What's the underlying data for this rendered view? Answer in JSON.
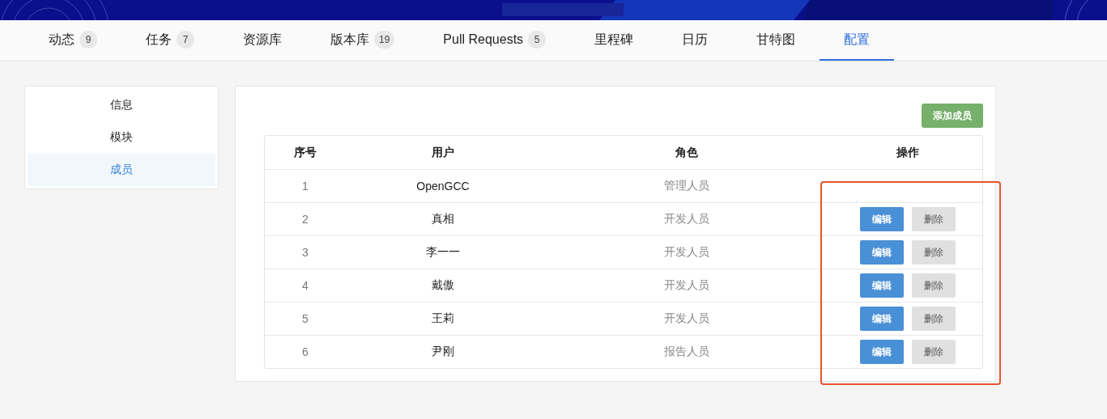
{
  "tabs": [
    {
      "label": "动态",
      "count": "9",
      "selected": false
    },
    {
      "label": "任务",
      "count": "7",
      "selected": false
    },
    {
      "label": "资源库",
      "selected": false
    },
    {
      "label": "版本库",
      "count": "19",
      "selected": false
    },
    {
      "label": "Pull Requests",
      "count": "5",
      "selected": false
    },
    {
      "label": "里程碑",
      "selected": false
    },
    {
      "label": "日历",
      "selected": false
    },
    {
      "label": "甘特图",
      "selected": false
    },
    {
      "label": "配置",
      "selected": true
    }
  ],
  "sidebar": {
    "items": [
      {
        "label": "信息",
        "selected": false
      },
      {
        "label": "模块",
        "selected": false
      },
      {
        "label": "成员",
        "selected": true
      }
    ]
  },
  "add_button": "添加成员",
  "table": {
    "columns": [
      "序号",
      "用户",
      "角色",
      "操作"
    ],
    "rows": [
      {
        "index": "1",
        "user": "OpenGCC",
        "role": "管理人员"
      },
      {
        "index": "2",
        "user": "真相",
        "role": "开发人员",
        "actions": [
          {
            "kind": "edit",
            "label": "编辑"
          },
          {
            "kind": "delete",
            "label": "删除"
          }
        ]
      },
      {
        "index": "3",
        "user": "李一一",
        "role": "开发人员",
        "actions": [
          {
            "kind": "edit",
            "label": "编辑"
          },
          {
            "kind": "delete",
            "label": "删除"
          }
        ]
      },
      {
        "index": "4",
        "user": "戴傲",
        "role": "开发人员",
        "actions": [
          {
            "kind": "edit",
            "label": "编辑"
          },
          {
            "kind": "delete",
            "label": "删除"
          }
        ]
      },
      {
        "index": "5",
        "user": "王莉",
        "role": "开发人员",
        "actions": [
          {
            "kind": "edit",
            "label": "编辑"
          },
          {
            "kind": "delete",
            "label": "删除"
          }
        ]
      },
      {
        "index": "6",
        "user": "尹刚",
        "role": "报告人员",
        "actions": [
          {
            "kind": "edit",
            "label": "编辑"
          },
          {
            "kind": "delete",
            "label": "删除"
          }
        ]
      }
    ]
  },
  "highlight": {
    "shown": true
  }
}
